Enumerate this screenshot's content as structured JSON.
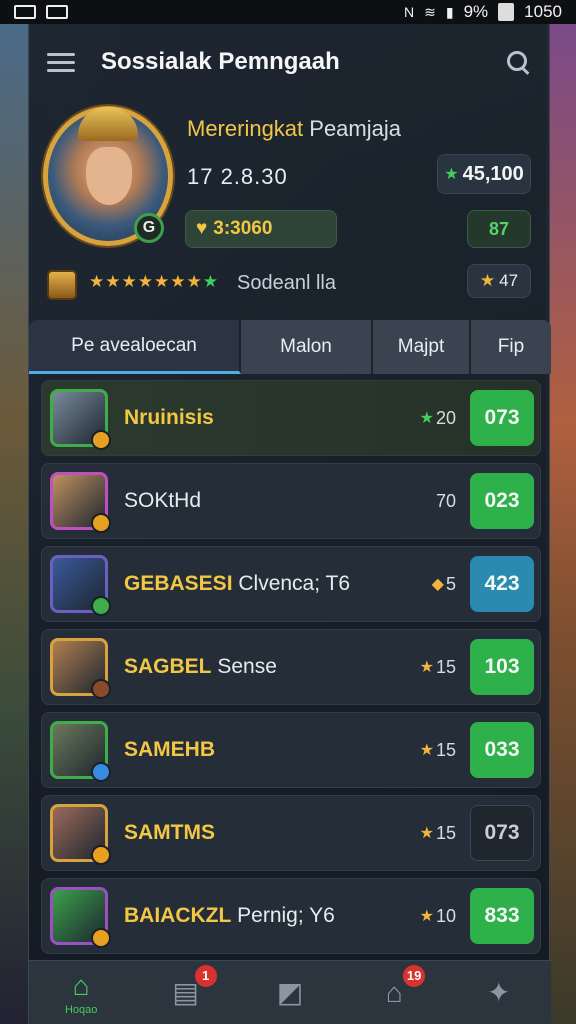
{
  "status_bar": {
    "time": "1050",
    "battery": "9%",
    "icons": [
      "sim-icon",
      "image-icon",
      "nfc-icon",
      "sync-icon",
      "wifi-icon",
      "signal-icon",
      "battery-icon"
    ]
  },
  "header": {
    "title": "Sossialak Pemngaah"
  },
  "profile": {
    "title_highlight": "Mereringkat",
    "title_rest": " Peamjaja",
    "score": "17 2.8.30",
    "points": "45,100",
    "coins": "3:3060",
    "small_value": "87",
    "level_badge": "G",
    "stars_label": "Sodeanl lla",
    "gold_stars": "★★★★★★★",
    "green_star": "★",
    "trophy_value": "47"
  },
  "tabs": [
    {
      "label": "Pe avealoecan",
      "active": true
    },
    {
      "label": "Malon",
      "active": false
    },
    {
      "label": "Majpt",
      "active": false
    },
    {
      "label": "Fip",
      "active": false
    }
  ],
  "leaderboard": [
    {
      "name_highlight": "Nruinisis",
      "name_rest": "",
      "stat_icon": "★",
      "stat": "20",
      "score": "073",
      "score_color": "#2eb04a",
      "border_color": "#3fae4a",
      "avatar_color": "#7a8a9a",
      "dot_color": "#e8a020",
      "stat_icon_color": "#3fcf5a"
    },
    {
      "name_highlight": "",
      "name_rest": "SOKtHd",
      "stat_icon": "",
      "stat": "70",
      "score": "023",
      "score_color": "#2eb04a",
      "border_color": "#c050c0",
      "avatar_color": "#c09060",
      "dot_color": "#e8a020",
      "stat_icon_color": "#f2b43a"
    },
    {
      "name_highlight": "GEBASESI",
      "name_rest": " Clvenca; T6",
      "stat_icon": "◆",
      "stat": "5",
      "score": "423",
      "score_color": "#2a8ab0",
      "border_color": "#6a60c0",
      "avatar_color": "#3a5a9a",
      "dot_color": "#3fae4a",
      "stat_icon_color": "#f2b43a"
    },
    {
      "name_highlight": "SAGBEL",
      "name_rest": " Sense",
      "stat_icon": "★",
      "stat": "15",
      "score": "103",
      "score_color": "#2eb04a",
      "border_color": "#d7a33c",
      "avatar_color": "#b08050",
      "dot_color": "#8a4a2a",
      "stat_icon_color": "#f2b43a"
    },
    {
      "name_highlight": "SAMEHB",
      "name_rest": "",
      "stat_icon": "★",
      "stat": "15",
      "score": "033",
      "score_color": "#2eb04a",
      "border_color": "#3fae4a",
      "avatar_color": "#6a7a5a",
      "dot_color": "#3a8ae0",
      "stat_icon_color": "#f2b43a"
    },
    {
      "name_highlight": "SAMTMS",
      "name_rest": "",
      "stat_icon": "★",
      "stat": "15",
      "score": "073",
      "score_color": "#1f262e",
      "border_color": "#d7a33c",
      "avatar_color": "#9a6a5a",
      "dot_color": "#e8a020",
      "stat_icon_color": "#f2b43a"
    },
    {
      "name_highlight": "BAIACKZL",
      "name_rest": " Pernig; Y6",
      "stat_icon": "★",
      "stat": "10",
      "score": "833",
      "score_color": "#2eb04a",
      "border_color": "#9a50c0",
      "avatar_color": "#3aa04a",
      "dot_color": "#e8a020",
      "stat_icon_color": "#f2b43a"
    }
  ],
  "bottom_nav": [
    {
      "icon": "home-icon",
      "glyph": "⌂",
      "label": "Hoqao",
      "badge": "",
      "active": true
    },
    {
      "icon": "inbox-icon",
      "glyph": "▤",
      "label": "",
      "badge": "1",
      "active": false
    },
    {
      "icon": "card-icon",
      "glyph": "◩",
      "label": "",
      "badge": "",
      "active": false
    },
    {
      "icon": "guild-icon",
      "glyph": "⌂",
      "label": "",
      "badge": "19",
      "active": false
    },
    {
      "icon": "pet-icon",
      "glyph": "✦",
      "label": "",
      "badge": "",
      "active": false
    }
  ]
}
